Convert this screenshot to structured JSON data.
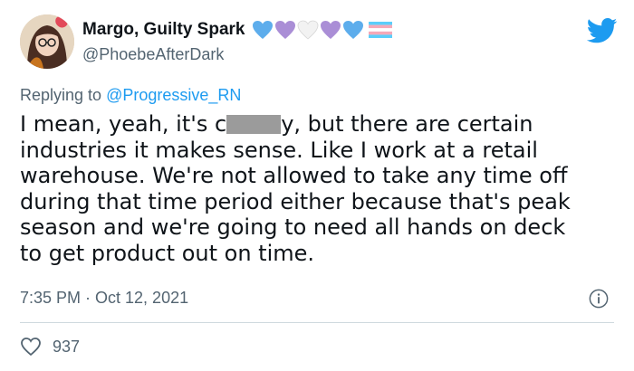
{
  "account": {
    "display_name": "Margo, Guilty Spark",
    "handle": "@PhoebeAfterDark",
    "name_emoji": [
      "blue-heart-icon",
      "purple-heart-icon",
      "white-heart-icon",
      "purple-heart-icon",
      "blue-heart-icon",
      "transgender-flag-icon"
    ]
  },
  "reply": {
    "prefix": "Replying to",
    "mention": "@Progressive_RN"
  },
  "tweet": {
    "text_before": "I mean, yeah, it's c",
    "text_after": "y, but there are certain\nindustries it makes sense. Like I work at a retail\nwarehouse. We're not allowed to take any time off\nduring that time period either because that's peak\nseason and we're going to need all hands on deck\nto get product out on time.",
    "timestamp": "7:35 PM · Oct 12, 2021"
  },
  "engagement": {
    "likes": "937"
  },
  "colors": {
    "accent": "#1d9bf0",
    "muted": "#536471",
    "text": "#0f1419",
    "divider": "#cfd9de"
  }
}
